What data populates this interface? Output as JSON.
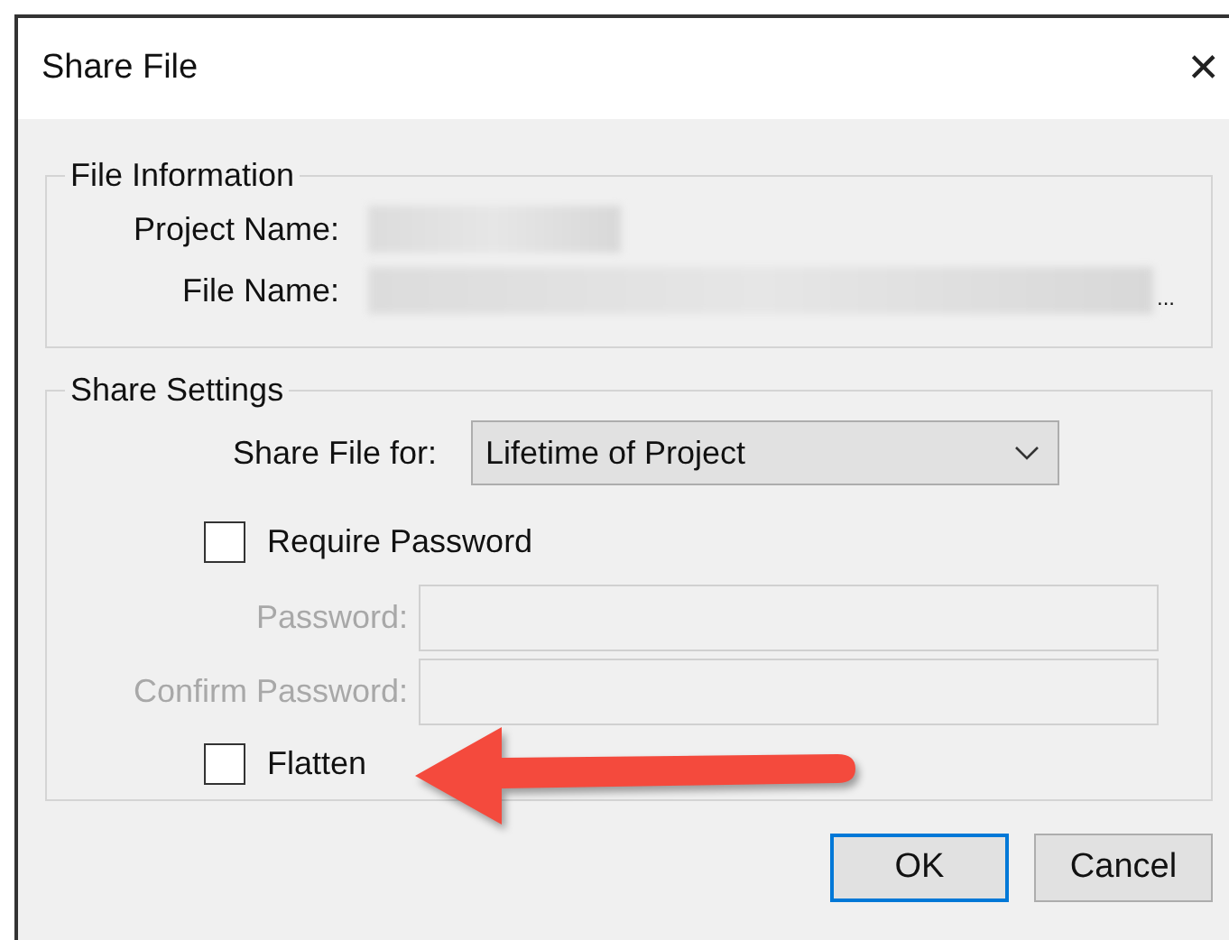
{
  "window": {
    "title": "Share File",
    "close": "✕"
  },
  "file_information": {
    "title": "File Information",
    "fields": [
      {
        "label": "Project Name:",
        "kind": "blurred"
      },
      {
        "label": "File Name:",
        "kind": "blurred",
        "ellipsis": "..."
      }
    ]
  },
  "share_settings": {
    "title": "Share Settings",
    "share_for": {
      "label": "Share File for:",
      "value": "Lifetime of Project"
    },
    "require_password": {
      "label": "Require Password",
      "checked": false
    },
    "password_fields": [
      {
        "label": "Password:",
        "disabled": true
      },
      {
        "label": "Confirm Password:",
        "disabled": true
      }
    ],
    "flatten": {
      "label": "Flatten",
      "checked": false
    }
  },
  "annotation": {
    "kind": "arrow"
  },
  "buttons": [
    {
      "label": "OK",
      "default": true
    },
    {
      "label": "Cancel",
      "default": false
    }
  ]
}
